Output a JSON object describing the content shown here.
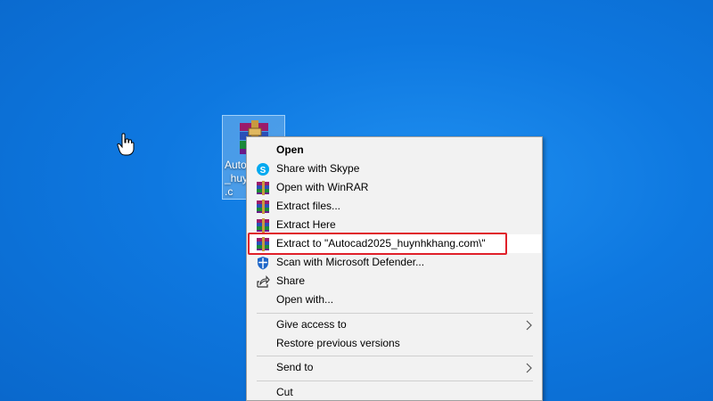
{
  "desktop": {
    "icon_label": "Autoc\n_huyn\n.c"
  },
  "menu": {
    "items": [
      {
        "label": "Open",
        "icon": "none"
      },
      {
        "label": "Share with Skype",
        "icon": "skype-icon"
      },
      {
        "label": "Open with WinRAR",
        "icon": "winrar-icon"
      },
      {
        "label": "Extract files...",
        "icon": "winrar-icon"
      },
      {
        "label": "Extract Here",
        "icon": "winrar-icon"
      },
      {
        "label": "Extract to \"Autocad2025_huynhkhang.com\\\"",
        "icon": "winrar-icon"
      },
      {
        "label": "Scan with Microsoft Defender...",
        "icon": "defender-shield-icon"
      },
      {
        "label": "Share",
        "icon": "share-icon"
      },
      {
        "label": "Open with...",
        "icon": "none"
      },
      {
        "label": "Give access to",
        "icon": "none",
        "submenu": true
      },
      {
        "label": "Restore previous versions",
        "icon": "none"
      },
      {
        "label": "Send to",
        "icon": "none",
        "submenu": true
      },
      {
        "label": "Cut",
        "icon": "none"
      }
    ]
  },
  "colors": {
    "desktop_background": "#0e78e0",
    "highlight_border": "#e0202a",
    "menu_background": "#f2f2f2"
  }
}
